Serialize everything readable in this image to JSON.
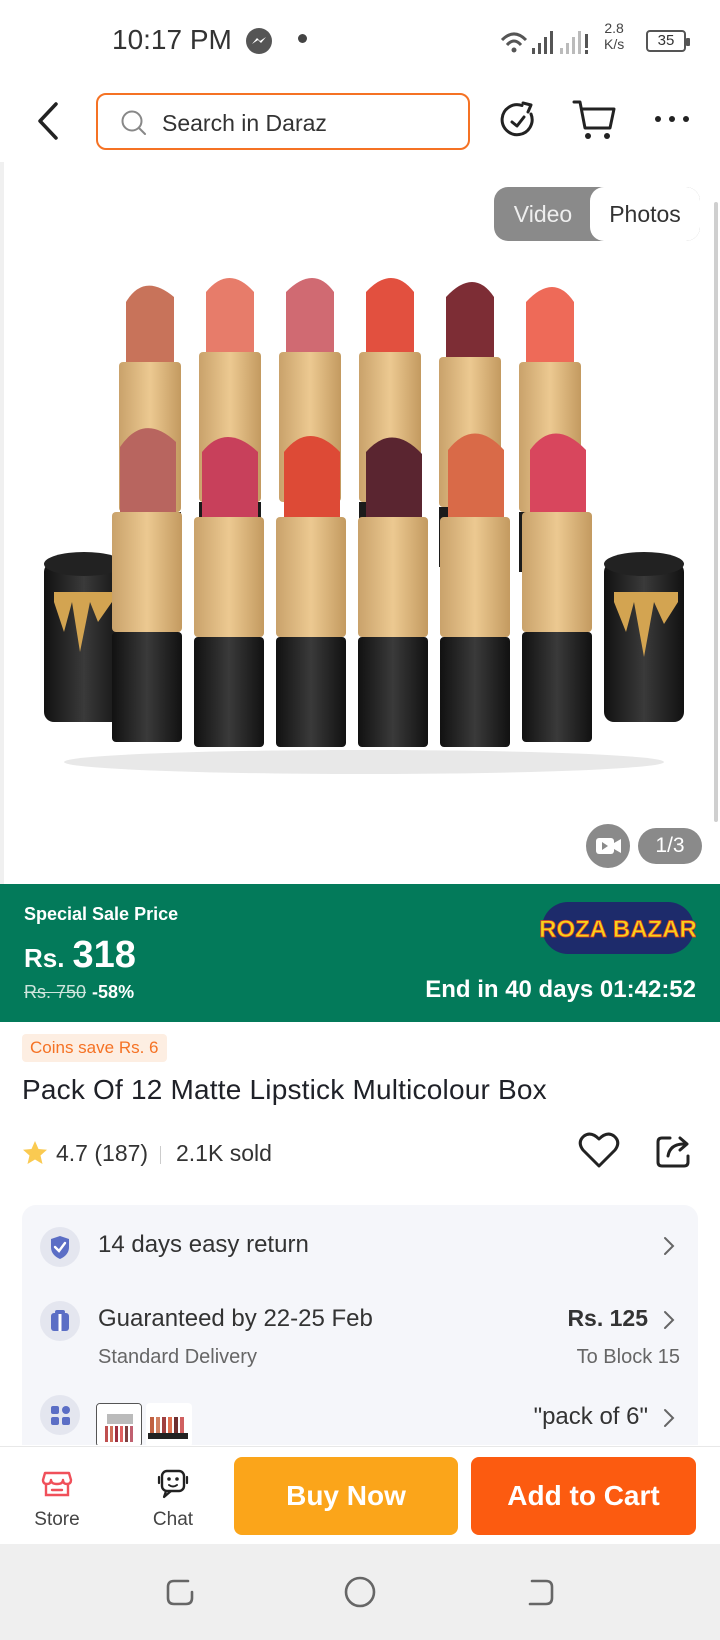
{
  "status_bar": {
    "time": "10:17 PM",
    "net_speed_value": "2.8",
    "net_speed_unit": "K/s",
    "battery": "35"
  },
  "header": {
    "search_placeholder": "Search in Daraz"
  },
  "gallery": {
    "video_label": "Video",
    "photos_label": "Photos",
    "image_counter": "1/3"
  },
  "price_banner": {
    "sale_label": "Special Sale Price",
    "currency": "Rs.",
    "price": "318",
    "old_price": "Rs. 750",
    "discount": "-58%",
    "store_name": "ROZA BAZAR",
    "countdown": "End in 40 days 01:42:52",
    "bg_color": "#037a5a"
  },
  "product": {
    "coins_badge": "Coins save Rs. 6",
    "title": "Pack Of 12 Matte Lipstick Multicolour Box",
    "rating": "4.7",
    "reviews": "(187)",
    "sold": "2.1K sold"
  },
  "services": {
    "return_text": "14 days easy return",
    "delivery_text": "Guaranteed by 22-25 Feb",
    "delivery_sub": "Standard Delivery",
    "delivery_fee": "Rs. 125",
    "delivery_location": "To Block 15",
    "variant_text": "\"pack of 6\""
  },
  "bottom_bar": {
    "store_label": "Store",
    "chat_label": "Chat",
    "buy_now_label": "Buy Now",
    "add_to_cart_label": "Add to Cart",
    "buy_now_color": "#fba51a",
    "add_to_cart_color": "#fc5b10"
  },
  "accent_color": "#f57224"
}
